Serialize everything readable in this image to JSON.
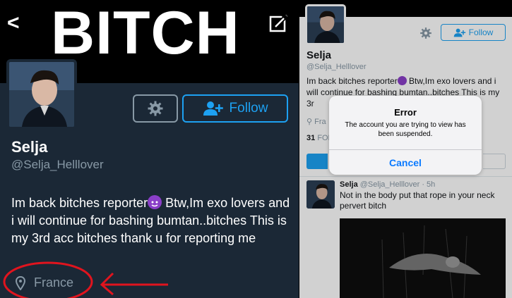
{
  "left": {
    "banner_text": "BITCH",
    "name": "Selja",
    "handle": "@Selja_Helllover",
    "follow_label": "Follow",
    "bio_part1": "Im back bitches reporter",
    "bio_part2": " Btw,Im exo lovers and i will continue for bashing bumtan..bitches This is my 3rd acc bitches thank u for reporting me",
    "location": "France"
  },
  "right": {
    "follow_label": "Follow",
    "name": "Selja",
    "handle": "@Selja_Helllover",
    "bio_part1": "Im back bitches reporter",
    "bio_part2": " Btw,Im exo lovers and i will continue for bashing bumtan..bitches This is my 3r",
    "location": "Fra",
    "count_num": "31",
    "count_label": "FOL",
    "tweet": {
      "name": "Selja",
      "meta": "@Selja_Helllover · 5h",
      "text": "Not in the body put that rope in your neck pervert bitch"
    },
    "dialog": {
      "title": "Error",
      "message": "The account you are trying to view has been suspended.",
      "cancel": "Cancel"
    }
  },
  "colors": {
    "twitter_blue": "#1da1f2",
    "dark_bg": "#1b2836",
    "muted": "#8899a6",
    "annotation_red": "#e0141e",
    "ios_blue": "#0a7aff"
  }
}
